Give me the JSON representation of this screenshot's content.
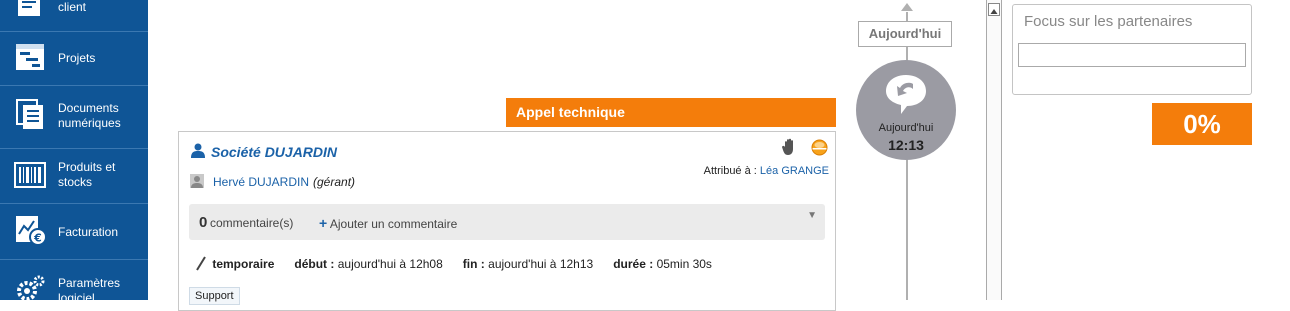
{
  "sidebar": {
    "items": [
      {
        "label_line1": "",
        "label_line2": "client",
        "icon": "contract-icon"
      },
      {
        "label_line1": "Projets",
        "label_line2": "",
        "icon": "gantt-icon"
      },
      {
        "label_line1": "Documents",
        "label_line2": "numériques",
        "icon": "documents-icon"
      },
      {
        "label_line1": "Produits et",
        "label_line2": "stocks",
        "icon": "barcode-icon"
      },
      {
        "label_line1": "Facturation",
        "label_line2": "",
        "icon": "invoice-euro-icon"
      },
      {
        "label_line1": "Paramètres",
        "label_line2": "logiciel",
        "icon": "gears-icon"
      }
    ]
  },
  "timeline": {
    "today_button": "Aujourd'hui",
    "clock_sublabel": "Aujourd'hui",
    "clock_time": "12:13"
  },
  "card": {
    "type_label": "Appel technique",
    "company": "Société DUJARDIN",
    "contact_name": "Hervé DUJARDIN",
    "contact_role": "(gérant)",
    "assigned_label": "Attribué à :",
    "assigned_user": "Léa GRANGE",
    "comment_count": "0",
    "comment_label": "commentaire(s)",
    "add_comment": "Ajouter un commentaire",
    "status": "temporaire",
    "start_label": "début :",
    "start_value": "aujourd'hui à 12h08",
    "end_label": "fin :",
    "end_value": "aujourd'hui à 12h13",
    "duration_label": "durée :",
    "duration_value": "05min 30s",
    "tag": "Support"
  },
  "partners": {
    "title": "Focus sur les partenaires",
    "input_value": "",
    "percent": "0%"
  },
  "colors": {
    "sidebar_bg": "#0f5596",
    "accent_orange": "#f47d0b",
    "link_blue": "#1b62a8"
  }
}
